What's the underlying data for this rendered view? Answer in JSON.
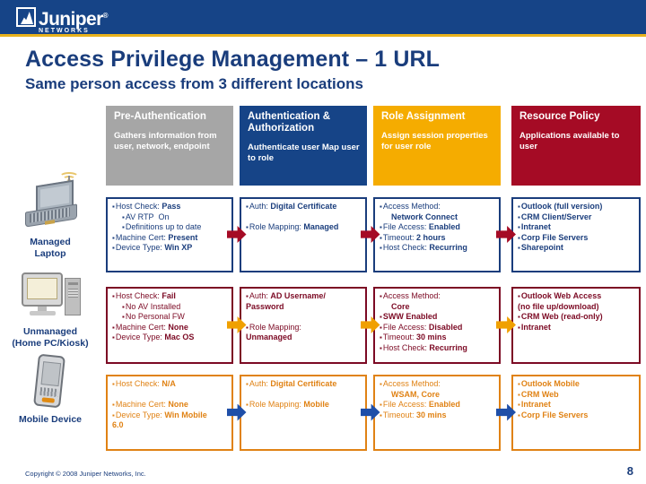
{
  "brand": {
    "name": "Juniper",
    "sub": "NETWORKS",
    "tm": "®",
    "banner_color": "#164487",
    "rule_color": "#e8b21c"
  },
  "title": "Access Privilege Management – 1 URL",
  "subtitle": "Same person access from 3 different locations",
  "columns": [
    {
      "title": "Pre-Authentication",
      "desc": "Gathers information from user, network, endpoint",
      "color": "#a6a6a6"
    },
    {
      "title": "Authentication & Authorization",
      "desc": "Authenticate user Map user to role",
      "color": "#164487"
    },
    {
      "title": "Role Assignment",
      "desc": "Assign session properties for user role",
      "color": "#f5ac00"
    },
    {
      "title": "Resource Policy",
      "desc": "Applications available to user",
      "color": "#a50b25"
    }
  ],
  "rows": [
    {
      "device": {
        "icon": "laptop-wifi-icon",
        "label1": "Managed",
        "label2": "Laptop"
      },
      "accent": "#1a3d7c",
      "arrow_color": "#a50b25",
      "cells": [
        [
          {
            "bullet": true,
            "text": "Host Check: ",
            "bold": "Pass",
            "indent": 0
          },
          {
            "bullet": true,
            "text": "AV RTP  On",
            "bold": "",
            "indent": 1
          },
          {
            "bullet": true,
            "text": "Definitions up to date",
            "bold": "",
            "indent": 1
          },
          {
            "bullet": true,
            "text": "Machine Cert: ",
            "bold": "Present",
            "indent": 0
          },
          {
            "bullet": true,
            "text": "Device Type: ",
            "bold": "Win XP",
            "indent": 0
          }
        ],
        [
          {
            "bullet": true,
            "text": "Auth: ",
            "bold": "Digital Certificate",
            "indent": 0
          },
          {
            "bullet": false,
            "text": "",
            "bold": "",
            "indent": 0
          },
          {
            "bullet": true,
            "text": "Role Mapping: ",
            "bold": "Managed",
            "indent": 0
          }
        ],
        [
          {
            "bullet": true,
            "text": "Access Method:",
            "bold": "",
            "indent": 0
          },
          {
            "bullet": false,
            "text": "",
            "bold": "Network Connect",
            "indent": 2
          },
          {
            "bullet": true,
            "text": "File Access: ",
            "bold": "Enabled",
            "indent": 0
          },
          {
            "bullet": true,
            "text": "Timeout: ",
            "bold": "2 hours",
            "indent": 0
          },
          {
            "bullet": true,
            "text": "Host Check: ",
            "bold": "Recurring",
            "indent": 0
          }
        ],
        [
          {
            "bullet": true,
            "text": "",
            "bold": "Outlook (full version)",
            "indent": 0
          },
          {
            "bullet": true,
            "text": "",
            "bold": "CRM Client/Server",
            "indent": 0
          },
          {
            "bullet": true,
            "text": "",
            "bold": "Intranet",
            "indent": 0
          },
          {
            "bullet": true,
            "text": "",
            "bold": "Corp File Servers",
            "indent": 0
          },
          {
            "bullet": true,
            "text": "",
            "bold": "Sharepoint",
            "indent": 0
          }
        ]
      ]
    },
    {
      "device": {
        "icon": "desktop-pc-icon",
        "label1": "Unmanaged",
        "label2": "(Home PC/Kiosk)"
      },
      "accent": "#7c0a24",
      "arrow_color": "#f0a000",
      "cells": [
        [
          {
            "bullet": true,
            "text": "Host Check: ",
            "bold": "Fail",
            "indent": 0
          },
          {
            "bullet": true,
            "text": "No AV Installed",
            "bold": "",
            "indent": 1
          },
          {
            "bullet": true,
            "text": "No Personal FW",
            "bold": "",
            "indent": 1
          },
          {
            "bullet": true,
            "text": "Machine Cert: ",
            "bold": "None",
            "indent": 0
          },
          {
            "bullet": true,
            "text": "Device Type: ",
            "bold": "Mac OS",
            "indent": 0
          }
        ],
        [
          {
            "bullet": true,
            "text": "Auth: ",
            "bold": "AD Username/",
            "indent": 0
          },
          {
            "bullet": false,
            "text": "",
            "bold": "Password",
            "indent": 0
          },
          {
            "bullet": false,
            "text": "",
            "bold": "",
            "indent": 0
          },
          {
            "bullet": true,
            "text": "Role Mapping:",
            "bold": "",
            "indent": 0
          },
          {
            "bullet": false,
            "text": "",
            "bold": "Unmanaged",
            "indent": 0
          }
        ],
        [
          {
            "bullet": true,
            "text": "Access Method:",
            "bold": "",
            "indent": 0
          },
          {
            "bullet": false,
            "text": "",
            "bold": "Core",
            "indent": 2
          },
          {
            "bullet": true,
            "text": "",
            "bold": "SWW Enabled",
            "indent": 0
          },
          {
            "bullet": true,
            "text": "File Access: ",
            "bold": "Disabled",
            "indent": 0
          },
          {
            "bullet": true,
            "text": "Timeout: ",
            "bold": "30 mins",
            "indent": 0
          },
          {
            "bullet": true,
            "text": "Host Check: ",
            "bold": "Recurring",
            "indent": 0
          }
        ],
        [
          {
            "bullet": true,
            "text": "",
            "bold": "Outlook Web Access",
            "indent": 0
          },
          {
            "bullet": false,
            "text": "",
            "bold": "(no file up/download)",
            "indent": 0
          },
          {
            "bullet": true,
            "text": "",
            "bold": "CRM Web (read-only)",
            "indent": 0
          },
          {
            "bullet": true,
            "text": "",
            "bold": "Intranet",
            "indent": 0
          }
        ]
      ]
    },
    {
      "device": {
        "icon": "mobile-device-icon",
        "label1": "Mobile Device",
        "label2": ""
      },
      "accent": "#e08214",
      "arrow_color": "#1f4fa8",
      "cells": [
        [
          {
            "bullet": true,
            "text": "Host Check: ",
            "bold": "N/A",
            "indent": 0
          },
          {
            "bullet": false,
            "text": "",
            "bold": "",
            "indent": 0
          },
          {
            "bullet": true,
            "text": "Machine Cert: ",
            "bold": "None",
            "indent": 0
          },
          {
            "bullet": true,
            "text": "Device Type: ",
            "bold": "Win Mobile",
            "indent": 0
          },
          {
            "bullet": false,
            "text": "",
            "bold": "6.0",
            "indent": 0
          }
        ],
        [
          {
            "bullet": true,
            "text": "Auth: ",
            "bold": "Digital Certificate",
            "indent": 0
          },
          {
            "bullet": false,
            "text": "",
            "bold": "",
            "indent": 0
          },
          {
            "bullet": true,
            "text": "Role Mapping: ",
            "bold": "Mobile",
            "indent": 0
          }
        ],
        [
          {
            "bullet": true,
            "text": "Access Method:",
            "bold": "",
            "indent": 0
          },
          {
            "bullet": false,
            "text": "",
            "bold": "WSAM, Core",
            "indent": 2
          },
          {
            "bullet": true,
            "text": "File Access: ",
            "bold": "Enabled",
            "indent": 0
          },
          {
            "bullet": true,
            "text": "Timeout: ",
            "bold": "30 mins",
            "indent": 0
          }
        ],
        [
          {
            "bullet": true,
            "text": "",
            "bold": "Outlook Mobile",
            "indent": 0
          },
          {
            "bullet": true,
            "text": "",
            "bold": "CRM Web",
            "indent": 0
          },
          {
            "bullet": true,
            "text": "",
            "bold": "Intranet",
            "indent": 0
          },
          {
            "bullet": true,
            "text": "",
            "bold": "Corp File Servers",
            "indent": 0
          }
        ]
      ]
    }
  ],
  "footer": {
    "copyright": "Copyright © 2008 Juniper Networks, Inc.",
    "page": "8"
  }
}
